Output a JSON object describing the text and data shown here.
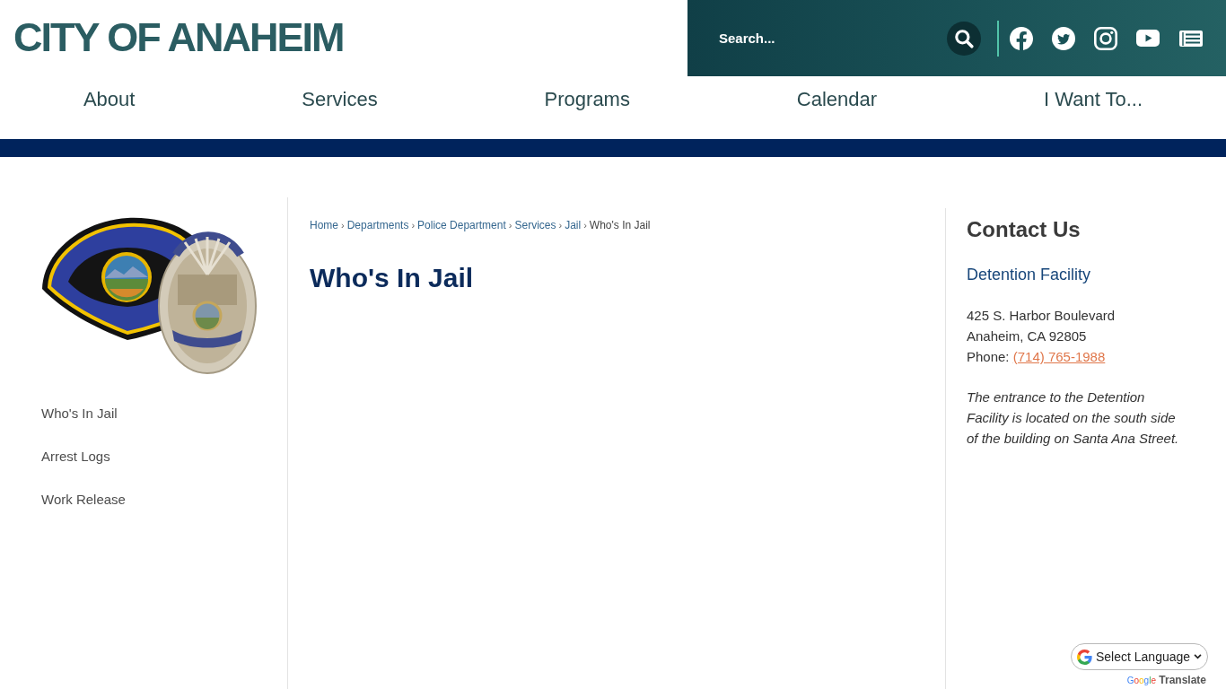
{
  "header": {
    "logo": "CITY OF ANAHEIM",
    "search": {
      "placeholder": "Search..."
    }
  },
  "nav": [
    {
      "label": "About"
    },
    {
      "label": "Services"
    },
    {
      "label": "Programs"
    },
    {
      "label": "Calendar"
    },
    {
      "label": "I Want To..."
    }
  ],
  "sidebar": {
    "items": [
      {
        "label": "Who's In Jail"
      },
      {
        "label": "Arrest Logs"
      },
      {
        "label": "Work Release"
      }
    ]
  },
  "breadcrumb": {
    "separator": "›",
    "items": [
      {
        "label": "Home",
        "current": false
      },
      {
        "label": "Departments",
        "current": false
      },
      {
        "label": "Police Department",
        "current": false
      },
      {
        "label": "Services",
        "current": false
      },
      {
        "label": "Jail",
        "current": false
      },
      {
        "label": "Who's In Jail",
        "current": true
      }
    ]
  },
  "page_title": "Who's In Jail",
  "contact": {
    "title": "Contact Us",
    "name": "Detention Facility",
    "address_lines": [
      "425 S. Harbor Boulevard",
      "Anaheim, CA 92805"
    ],
    "phone_label": "Phone:",
    "phone": "(714) 765-1988",
    "note": "The entrance to the Detention Facility is located on the south side of the building on Santa Ana Street."
  },
  "translate": {
    "select_label": "Select Language",
    "brand": "Google",
    "label": "Translate"
  }
}
